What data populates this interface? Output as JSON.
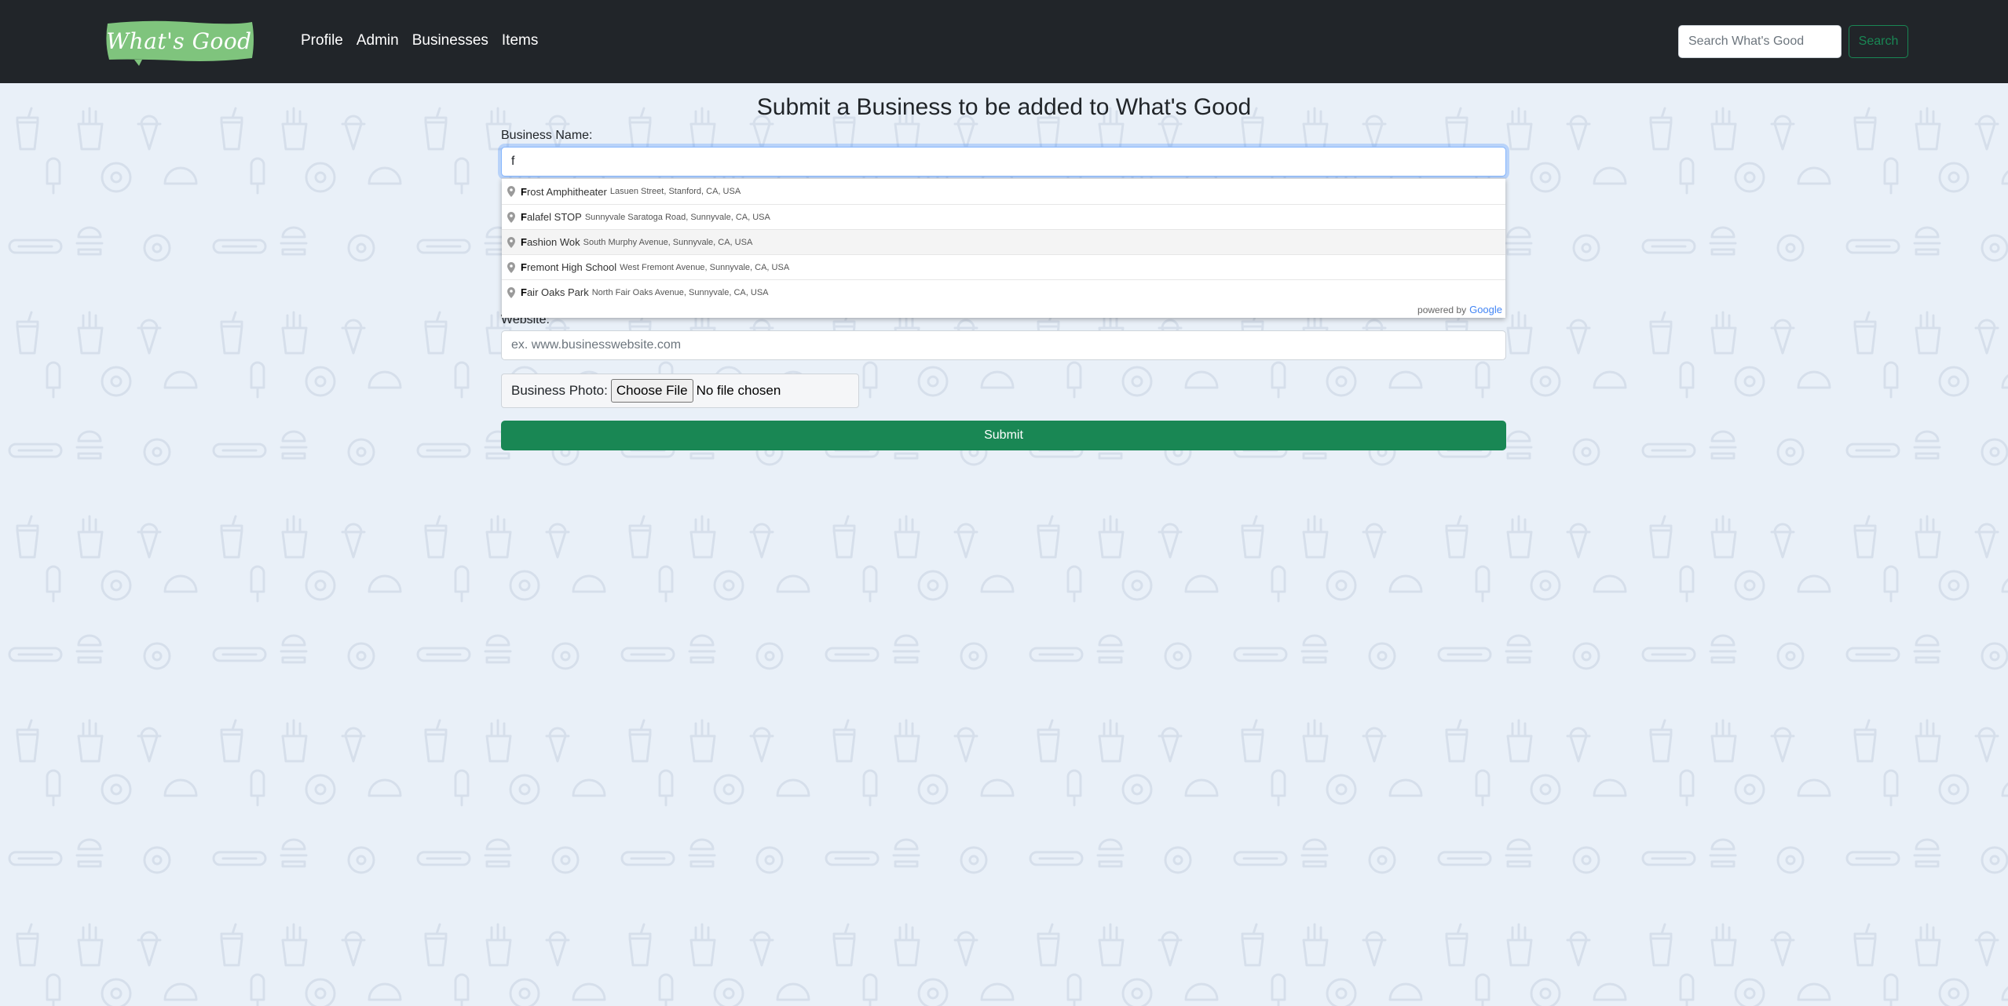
{
  "navbar": {
    "brand": "What's Good",
    "links": [
      "Profile",
      "Admin",
      "Businesses",
      "Items"
    ],
    "search_placeholder": "Search What's Good",
    "search_button": "Search"
  },
  "form": {
    "title": "Submit a Business to be added to What's Good",
    "business_name_label": "Business Name:",
    "business_name_value": "f",
    "website_label": "Website:",
    "website_placeholder": "ex. www.businesswebsite.com",
    "photo_label": "Business Photo:",
    "choose_file": "Choose File",
    "file_status": "No file chosen",
    "submit": "Submit"
  },
  "autocomplete": {
    "suggestions": [
      {
        "match": "F",
        "rest": "rost Amphitheater",
        "secondary": "Lasuen Street, Stanford, CA, USA"
      },
      {
        "match": "F",
        "rest": "alafel STOP",
        "secondary": "Sunnyvale Saratoga Road, Sunnyvale, CA, USA"
      },
      {
        "match": "F",
        "rest": "ashion Wok",
        "secondary": "South Murphy Avenue, Sunnyvale, CA, USA"
      },
      {
        "match": "F",
        "rest": "remont High School",
        "secondary": "West Fremont Avenue, Sunnyvale, CA, USA"
      },
      {
        "match": "F",
        "rest": "air Oaks Park",
        "secondary": "North Fair Oaks Avenue, Sunnyvale, CA, USA"
      }
    ],
    "powered_by": "powered by",
    "google": "Google",
    "highlighted_index": 2
  },
  "colors": {
    "navbar": "#212529",
    "accent": "#198754",
    "background": "#e9f0f8",
    "brand_badge": "#7fc47d"
  }
}
